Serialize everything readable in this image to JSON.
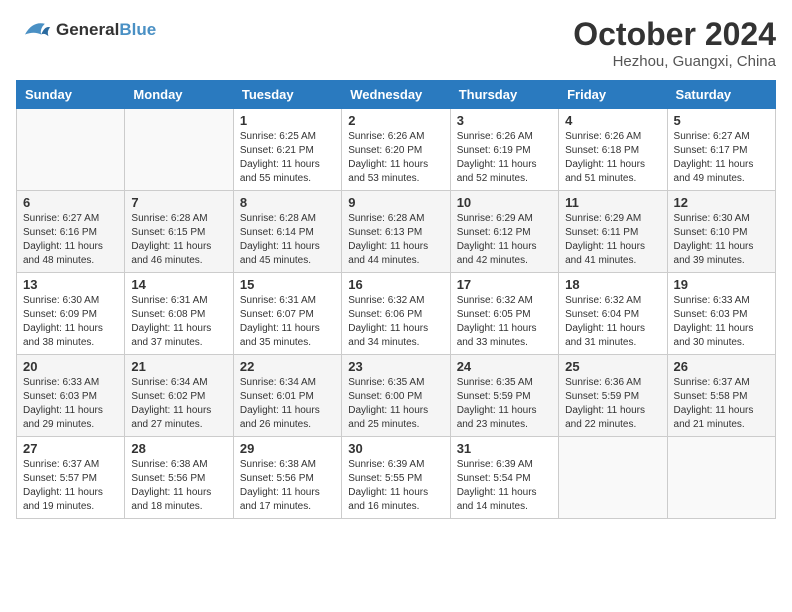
{
  "header": {
    "logo_line1": "General",
    "logo_line2": "Blue",
    "month_year": "October 2024",
    "location": "Hezhou, Guangxi, China"
  },
  "weekdays": [
    "Sunday",
    "Monday",
    "Tuesday",
    "Wednesday",
    "Thursday",
    "Friday",
    "Saturday"
  ],
  "weeks": [
    [
      {
        "day": "",
        "info": ""
      },
      {
        "day": "",
        "info": ""
      },
      {
        "day": "1",
        "info": "Sunrise: 6:25 AM\nSunset: 6:21 PM\nDaylight: 11 hours\nand 55 minutes."
      },
      {
        "day": "2",
        "info": "Sunrise: 6:26 AM\nSunset: 6:20 PM\nDaylight: 11 hours\nand 53 minutes."
      },
      {
        "day": "3",
        "info": "Sunrise: 6:26 AM\nSunset: 6:19 PM\nDaylight: 11 hours\nand 52 minutes."
      },
      {
        "day": "4",
        "info": "Sunrise: 6:26 AM\nSunset: 6:18 PM\nDaylight: 11 hours\nand 51 minutes."
      },
      {
        "day": "5",
        "info": "Sunrise: 6:27 AM\nSunset: 6:17 PM\nDaylight: 11 hours\nand 49 minutes."
      }
    ],
    [
      {
        "day": "6",
        "info": "Sunrise: 6:27 AM\nSunset: 6:16 PM\nDaylight: 11 hours\nand 48 minutes."
      },
      {
        "day": "7",
        "info": "Sunrise: 6:28 AM\nSunset: 6:15 PM\nDaylight: 11 hours\nand 46 minutes."
      },
      {
        "day": "8",
        "info": "Sunrise: 6:28 AM\nSunset: 6:14 PM\nDaylight: 11 hours\nand 45 minutes."
      },
      {
        "day": "9",
        "info": "Sunrise: 6:28 AM\nSunset: 6:13 PM\nDaylight: 11 hours\nand 44 minutes."
      },
      {
        "day": "10",
        "info": "Sunrise: 6:29 AM\nSunset: 6:12 PM\nDaylight: 11 hours\nand 42 minutes."
      },
      {
        "day": "11",
        "info": "Sunrise: 6:29 AM\nSunset: 6:11 PM\nDaylight: 11 hours\nand 41 minutes."
      },
      {
        "day": "12",
        "info": "Sunrise: 6:30 AM\nSunset: 6:10 PM\nDaylight: 11 hours\nand 39 minutes."
      }
    ],
    [
      {
        "day": "13",
        "info": "Sunrise: 6:30 AM\nSunset: 6:09 PM\nDaylight: 11 hours\nand 38 minutes."
      },
      {
        "day": "14",
        "info": "Sunrise: 6:31 AM\nSunset: 6:08 PM\nDaylight: 11 hours\nand 37 minutes."
      },
      {
        "day": "15",
        "info": "Sunrise: 6:31 AM\nSunset: 6:07 PM\nDaylight: 11 hours\nand 35 minutes."
      },
      {
        "day": "16",
        "info": "Sunrise: 6:32 AM\nSunset: 6:06 PM\nDaylight: 11 hours\nand 34 minutes."
      },
      {
        "day": "17",
        "info": "Sunrise: 6:32 AM\nSunset: 6:05 PM\nDaylight: 11 hours\nand 33 minutes."
      },
      {
        "day": "18",
        "info": "Sunrise: 6:32 AM\nSunset: 6:04 PM\nDaylight: 11 hours\nand 31 minutes."
      },
      {
        "day": "19",
        "info": "Sunrise: 6:33 AM\nSunset: 6:03 PM\nDaylight: 11 hours\nand 30 minutes."
      }
    ],
    [
      {
        "day": "20",
        "info": "Sunrise: 6:33 AM\nSunset: 6:03 PM\nDaylight: 11 hours\nand 29 minutes."
      },
      {
        "day": "21",
        "info": "Sunrise: 6:34 AM\nSunset: 6:02 PM\nDaylight: 11 hours\nand 27 minutes."
      },
      {
        "day": "22",
        "info": "Sunrise: 6:34 AM\nSunset: 6:01 PM\nDaylight: 11 hours\nand 26 minutes."
      },
      {
        "day": "23",
        "info": "Sunrise: 6:35 AM\nSunset: 6:00 PM\nDaylight: 11 hours\nand 25 minutes."
      },
      {
        "day": "24",
        "info": "Sunrise: 6:35 AM\nSunset: 5:59 PM\nDaylight: 11 hours\nand 23 minutes."
      },
      {
        "day": "25",
        "info": "Sunrise: 6:36 AM\nSunset: 5:59 PM\nDaylight: 11 hours\nand 22 minutes."
      },
      {
        "day": "26",
        "info": "Sunrise: 6:37 AM\nSunset: 5:58 PM\nDaylight: 11 hours\nand 21 minutes."
      }
    ],
    [
      {
        "day": "27",
        "info": "Sunrise: 6:37 AM\nSunset: 5:57 PM\nDaylight: 11 hours\nand 19 minutes."
      },
      {
        "day": "28",
        "info": "Sunrise: 6:38 AM\nSunset: 5:56 PM\nDaylight: 11 hours\nand 18 minutes."
      },
      {
        "day": "29",
        "info": "Sunrise: 6:38 AM\nSunset: 5:56 PM\nDaylight: 11 hours\nand 17 minutes."
      },
      {
        "day": "30",
        "info": "Sunrise: 6:39 AM\nSunset: 5:55 PM\nDaylight: 11 hours\nand 16 minutes."
      },
      {
        "day": "31",
        "info": "Sunrise: 6:39 AM\nSunset: 5:54 PM\nDaylight: 11 hours\nand 14 minutes."
      },
      {
        "day": "",
        "info": ""
      },
      {
        "day": "",
        "info": ""
      }
    ]
  ]
}
